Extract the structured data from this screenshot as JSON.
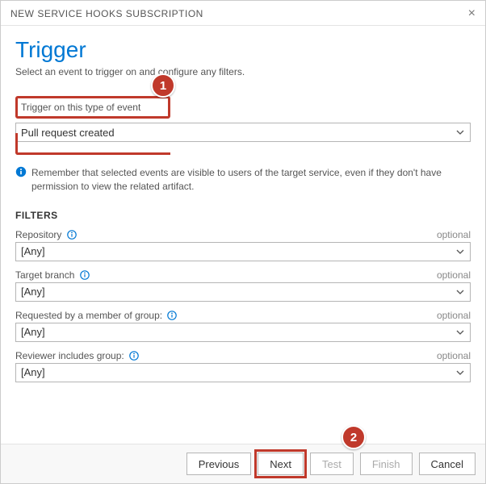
{
  "dialog": {
    "title": "NEW SERVICE HOOKS SUBSCRIPTION"
  },
  "header": {
    "heading": "Trigger",
    "subtitle": "Select an event to trigger on and configure any filters."
  },
  "trigger_event": {
    "label": "Trigger on this type of event",
    "value": "Pull request created"
  },
  "note": {
    "text": "Remember that selected events are visible to users of the target service, even if they don't have permission to view the related artifact."
  },
  "filters": {
    "heading": "FILTERS",
    "items": [
      {
        "label": "Repository",
        "optional": "optional",
        "value": "[Any]",
        "has_info": true
      },
      {
        "label": "Target branch",
        "optional": "optional",
        "value": "[Any]",
        "has_info": true
      },
      {
        "label": "Requested by a member of group:",
        "optional": "optional",
        "value": "[Any]",
        "has_info": true
      },
      {
        "label": "Reviewer includes group:",
        "optional": "optional",
        "value": "[Any]",
        "has_info": true
      }
    ]
  },
  "buttons": {
    "previous": "Previous",
    "next": "Next",
    "test": "Test",
    "finish": "Finish",
    "cancel": "Cancel"
  },
  "annotations": {
    "badge1": "1",
    "badge2": "2"
  }
}
